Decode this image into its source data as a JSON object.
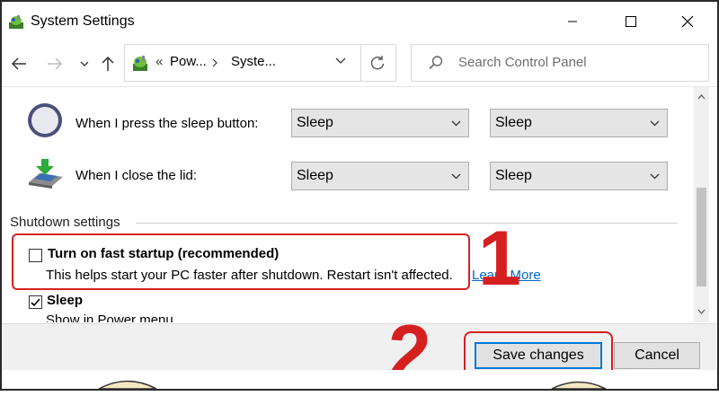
{
  "window": {
    "title": "System Settings",
    "icon": "control-panel-icon"
  },
  "nav": {
    "back_icon": "arrow-left-icon",
    "forward_icon": "arrow-right-icon",
    "recent_icon": "chevron-down-icon",
    "up_icon": "arrow-up-icon",
    "address_prefix": "«",
    "breadcrumbs": [
      "Pow...",
      "Syste..."
    ],
    "refresh_icon": "refresh-icon",
    "search_placeholder": "Search Control Panel"
  },
  "settings": {
    "sleep_button": {
      "label": "When I press the sleep button:",
      "on_battery": "Sleep",
      "plugged_in": "Sleep"
    },
    "close_lid": {
      "label": "When I close the lid:",
      "on_battery": "Sleep",
      "plugged_in": "Sleep"
    }
  },
  "shutdown": {
    "heading": "Shutdown settings",
    "fast_startup": {
      "label": "Turn on fast startup (recommended)",
      "description": "This helps start your PC faster after shutdown. Restart isn't affected.",
      "link": "Learn More",
      "checked": false
    },
    "sleep": {
      "label": "Sleep",
      "description": "Show in Power menu.",
      "checked": true
    }
  },
  "annotations": {
    "step1": "1",
    "step2": "2",
    "color": "#d62020"
  },
  "footer": {
    "save_label": "Save changes",
    "cancel_label": "Cancel"
  },
  "colors": {
    "accent": "#0078d7",
    "link": "#0066cc"
  }
}
